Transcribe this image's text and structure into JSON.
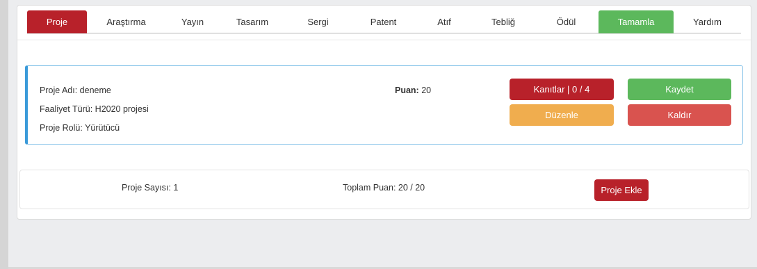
{
  "tabs": [
    {
      "label": "Proje",
      "state": "active"
    },
    {
      "label": "Araştırma",
      "state": "normal"
    },
    {
      "label": "Yayın",
      "state": "normal"
    },
    {
      "label": "Tasarım",
      "state": "normal"
    },
    {
      "label": "Sergi",
      "state": "normal"
    },
    {
      "label": "Patent",
      "state": "normal"
    },
    {
      "label": "Atıf",
      "state": "normal"
    },
    {
      "label": "Tebliğ",
      "state": "normal"
    },
    {
      "label": "Ödül",
      "state": "normal"
    },
    {
      "label": "Tamamla",
      "state": "complete"
    },
    {
      "label": "Yardım",
      "state": "normal"
    }
  ],
  "project": {
    "name_line": "Proje Adı: deneme",
    "activity_line": "Faaliyet Türü: H2020 projesi",
    "role_line": "Proje Rolü: Yürütücü",
    "score_label": "Puan:",
    "score_value": "20",
    "evidence_button": "Kanıtlar | 0 / 4",
    "save_button": "Kaydet",
    "edit_button": "Düzenle",
    "remove_button": "Kaldır"
  },
  "footer": {
    "project_count": "Proje Sayısı: 1",
    "total_score": "Toplam Puan: 20 / 20",
    "add_button": "Proje Ekle"
  },
  "colors": {
    "active_tab": "#b8212a",
    "complete_tab": "#5cb85c",
    "edit_button": "#f0ad4e",
    "remove_button": "#d9534f",
    "panel_accent": "#3a9ad9"
  }
}
